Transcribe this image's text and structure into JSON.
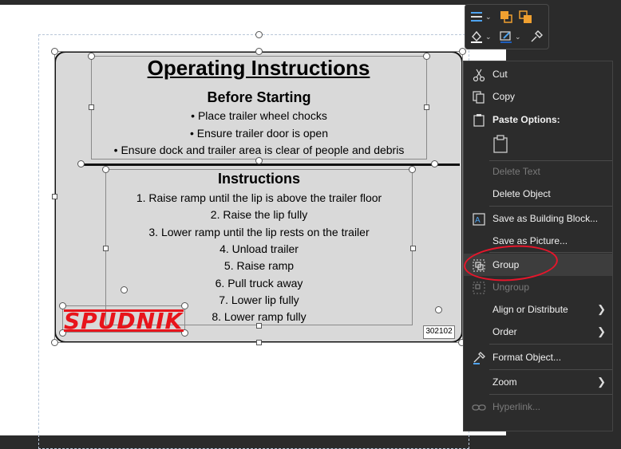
{
  "sign": {
    "title": "Operating Instructions",
    "before_heading": "Before Starting",
    "before_items": [
      "Place trailer wheel chocks",
      "Ensure trailer door is open",
      "Ensure dock and trailer area is clear of people and debris"
    ],
    "instructions_heading": "Instructions",
    "steps": [
      "1. Raise ramp until the lip is above the trailer floor",
      "2. Raise the lip fully",
      "3. Lower ramp until the lip rests on the trailer",
      "4. Unload trailer",
      "5. Raise ramp",
      "6. Pull truck away",
      "7. Lower lip fully",
      "8. Lower ramp fully"
    ],
    "logo_text": "SPUDNIK",
    "code": "302102"
  },
  "menu": {
    "items": [
      {
        "label": "Cut",
        "icon": "scissors-icon",
        "enabled": true
      },
      {
        "label": "Copy",
        "icon": "copy-icon",
        "enabled": true
      },
      {
        "label": "Paste Options:",
        "icon": "paste-icon",
        "enabled": true
      },
      {
        "label": "Delete Text",
        "icon": "",
        "enabled": false
      },
      {
        "label": "Delete Object",
        "icon": "",
        "enabled": true
      },
      {
        "label": "Save as Building Block...",
        "icon": "building-block-icon",
        "enabled": true
      },
      {
        "label": "Save as Picture...",
        "icon": "",
        "enabled": true
      },
      {
        "label": "Group",
        "icon": "group-icon",
        "enabled": true
      },
      {
        "label": "Ungroup",
        "icon": "ungroup-icon",
        "enabled": false
      },
      {
        "label": "Align or Distribute",
        "icon": "",
        "enabled": true
      },
      {
        "label": "Order",
        "icon": "",
        "enabled": true
      },
      {
        "label": "Format Object...",
        "icon": "format-object-icon",
        "enabled": true
      },
      {
        "label": "Zoom",
        "icon": "",
        "enabled": true
      },
      {
        "label": "Hyperlink...",
        "icon": "hyperlink-icon",
        "enabled": false
      }
    ]
  },
  "colors": {
    "annotation": "#e5162b",
    "logo": "#e8141b"
  }
}
